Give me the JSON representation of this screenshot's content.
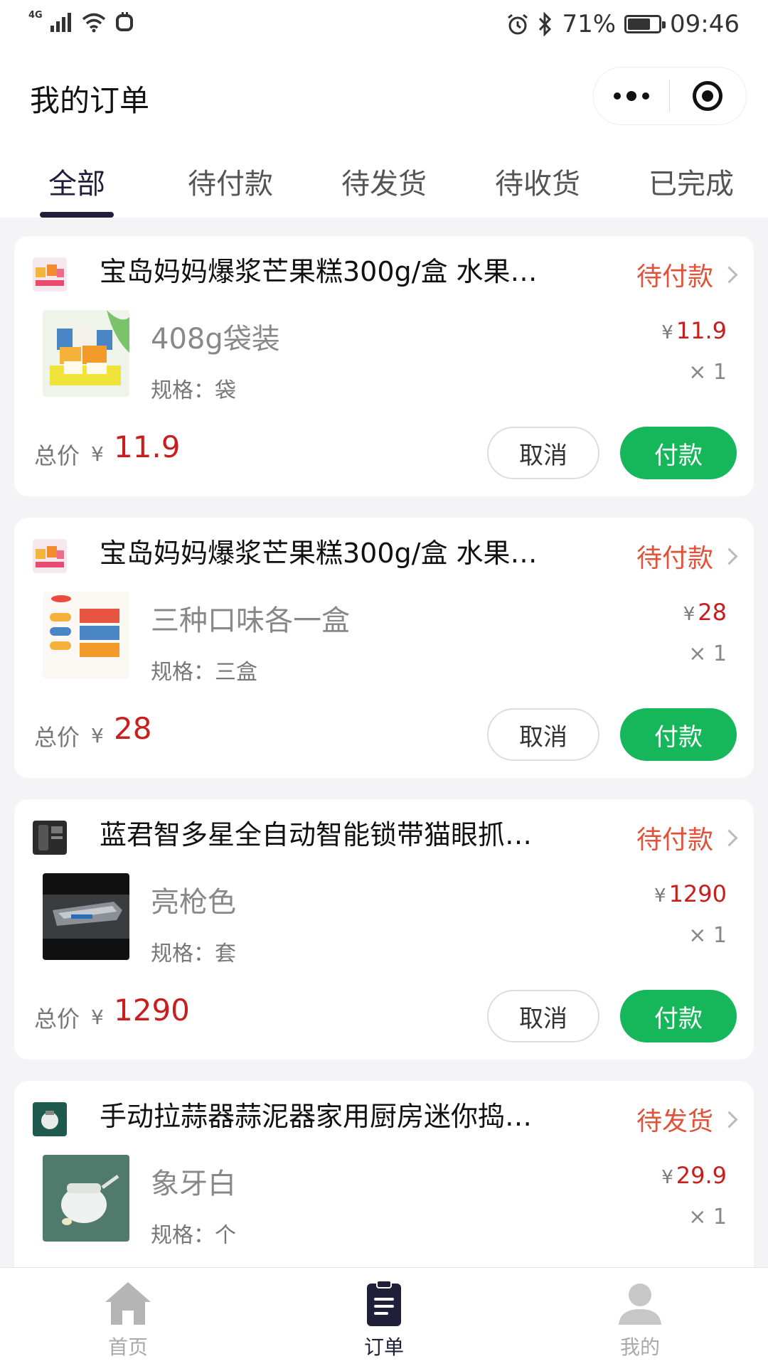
{
  "status_bar": {
    "network": "4G",
    "battery": "71%",
    "battery_level": 0.71,
    "time": "09:46"
  },
  "header": {
    "title": "我的订单"
  },
  "tabs": [
    {
      "label": "全部",
      "active": true
    },
    {
      "label": "待付款",
      "active": false
    },
    {
      "label": "待发货",
      "active": false
    },
    {
      "label": "待收货",
      "active": false
    },
    {
      "label": "已完成",
      "active": false
    }
  ],
  "common": {
    "total_label": "总价",
    "currency": "¥",
    "spec_prefix": "规格：",
    "cancel_label": "取消",
    "pay_label": "付款"
  },
  "orders": [
    {
      "title": "宝岛妈妈爆浆芒果糕300g/盒 水果…",
      "status": "待付款",
      "variant": "408g袋装",
      "spec": "规格：袋",
      "price": "11.9",
      "qty": "× 1",
      "total": "11.9"
    },
    {
      "title": "宝岛妈妈爆浆芒果糕300g/盒 水果…",
      "status": "待付款",
      "variant": "三种口味各一盒",
      "spec": "规格：三盒",
      "price": "28",
      "qty": "× 1",
      "total": "28"
    },
    {
      "title": "蓝君智多星全自动智能锁带猫眼抓…",
      "status": "待付款",
      "variant": "亮枪色",
      "spec": "规格：套",
      "price": "1290",
      "qty": "× 1",
      "total": "1290"
    },
    {
      "title": "手动拉蒜器蒜泥器家用厨房迷你捣…",
      "status": "待发货",
      "variant": "象牙白",
      "spec": "规格：个",
      "price": "29.9",
      "qty": "× 1"
    }
  ],
  "bottom_nav": [
    {
      "label": "首页",
      "icon": "home-icon",
      "active": false
    },
    {
      "label": "订单",
      "icon": "orders-icon",
      "active": true
    },
    {
      "label": "我的",
      "icon": "profile-icon",
      "active": false
    }
  ],
  "colors": {
    "accent": "#1f1f3a",
    "status_red": "#e0523a",
    "price_red": "#c81e1e",
    "pay_green": "#16b65a"
  }
}
